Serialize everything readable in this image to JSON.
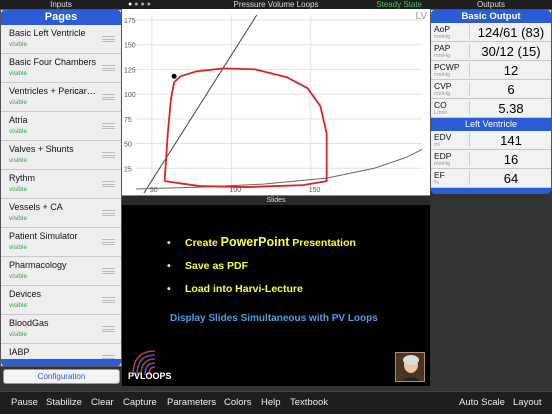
{
  "header": {
    "inputs": "Inputs",
    "title": "Pressure Volume Loops",
    "state": "Steady State",
    "outputs": "Outputs"
  },
  "pages": {
    "title": "Pages",
    "items": [
      {
        "label": "Basic Left Ventricle",
        "status": "visible"
      },
      {
        "label": "Basic Four Chambers",
        "status": "visible"
      },
      {
        "label": "Ventricles + Pericard...",
        "status": "visible"
      },
      {
        "label": "Atria",
        "status": "visible"
      },
      {
        "label": "Valves + Shunts",
        "status": "visible"
      },
      {
        "label": "Rythm",
        "status": "visible"
      },
      {
        "label": "Vessels + CA",
        "status": "visible"
      },
      {
        "label": "Patient Simulator",
        "status": "visible"
      },
      {
        "label": "Pharmacology",
        "status": "visible"
      },
      {
        "label": "Devices",
        "status": "visible"
      },
      {
        "label": "BloodGas",
        "status": "visible"
      },
      {
        "label": "IABP",
        "status": ""
      }
    ],
    "config_label": "Configuration"
  },
  "chart_data": {
    "type": "line",
    "title": "Pressure Volume Loops",
    "corner_label": "LV",
    "y_ticks": [
      25,
      50,
      75,
      100,
      125,
      150,
      175
    ],
    "x_ticks": [
      50,
      100,
      150
    ],
    "xlim": [
      40,
      220
    ],
    "ylim": [
      0,
      180
    ],
    "grid": true,
    "series": [
      {
        "color": "#dd2222",
        "values": [
          [
            58,
            12
          ],
          [
            60,
            60
          ],
          [
            62,
            95
          ],
          [
            64,
            112
          ],
          [
            68,
            118
          ],
          [
            78,
            123
          ],
          [
            95,
            126
          ],
          [
            115,
            125
          ],
          [
            135,
            117
          ],
          [
            148,
            106
          ],
          [
            156,
            88
          ],
          [
            160,
            60
          ],
          [
            160,
            12
          ],
          [
            145,
            8
          ],
          [
            110,
            6
          ],
          [
            80,
            7
          ],
          [
            58,
            12
          ]
        ]
      }
    ],
    "espvr_line": {
      "color": "#444444",
      "points": [
        [
          45,
          0
        ],
        [
          116,
          180
        ]
      ]
    },
    "edpvr_curve": {
      "color": "#666666",
      "points": [
        [
          40,
          4
        ],
        [
          80,
          6
        ],
        [
          120,
          9
        ],
        [
          160,
          15
        ],
        [
          190,
          25
        ],
        [
          210,
          36
        ],
        [
          220,
          44
        ]
      ]
    },
    "marker": {
      "x": 64,
      "y": 118
    }
  },
  "slides": {
    "bar_title": "Slides",
    "bullets": [
      {
        "pre": "Create ",
        "big": "PowerPoint",
        "post": " Presentation"
      },
      {
        "pre": "Save as PDF",
        "big": "",
        "post": ""
      },
      {
        "pre": "Load into Harvi-Lecture",
        "big": "",
        "post": ""
      }
    ],
    "caption": "Display Slides Simultaneous with PV Loops",
    "logo_text": "PVLOOPS"
  },
  "outputs": {
    "basic_title": "Basic Output",
    "basic": [
      {
        "label": "AoP",
        "unit": "mmHg",
        "value": "124/61 (83)"
      },
      {
        "label": "PAP",
        "unit": "mmHg",
        "value": "30/12 (15)"
      },
      {
        "label": "PCWP",
        "unit": "mmHg",
        "value": "12"
      },
      {
        "label": "CVP",
        "unit": "mmHg",
        "value": "6"
      },
      {
        "label": "CO",
        "unit": "L/min",
        "value": "5.38"
      }
    ],
    "lv_title": "Left Ventricle",
    "lv": [
      {
        "label": "EDV",
        "unit": "ml",
        "value": "141"
      },
      {
        "label": "EDP",
        "unit": "mmHg",
        "value": "16"
      },
      {
        "label": "EF",
        "unit": "%",
        "value": "64"
      }
    ]
  },
  "toolbar": {
    "pause": "Pause",
    "stabilize": "Stabilize",
    "clear": "Clear",
    "capture": "Capture",
    "parameters": "Parameters",
    "colors": "Colors",
    "help": "Help",
    "textbook": "Textbook",
    "auto_scale": "Auto Scale",
    "layout": "Layout"
  }
}
